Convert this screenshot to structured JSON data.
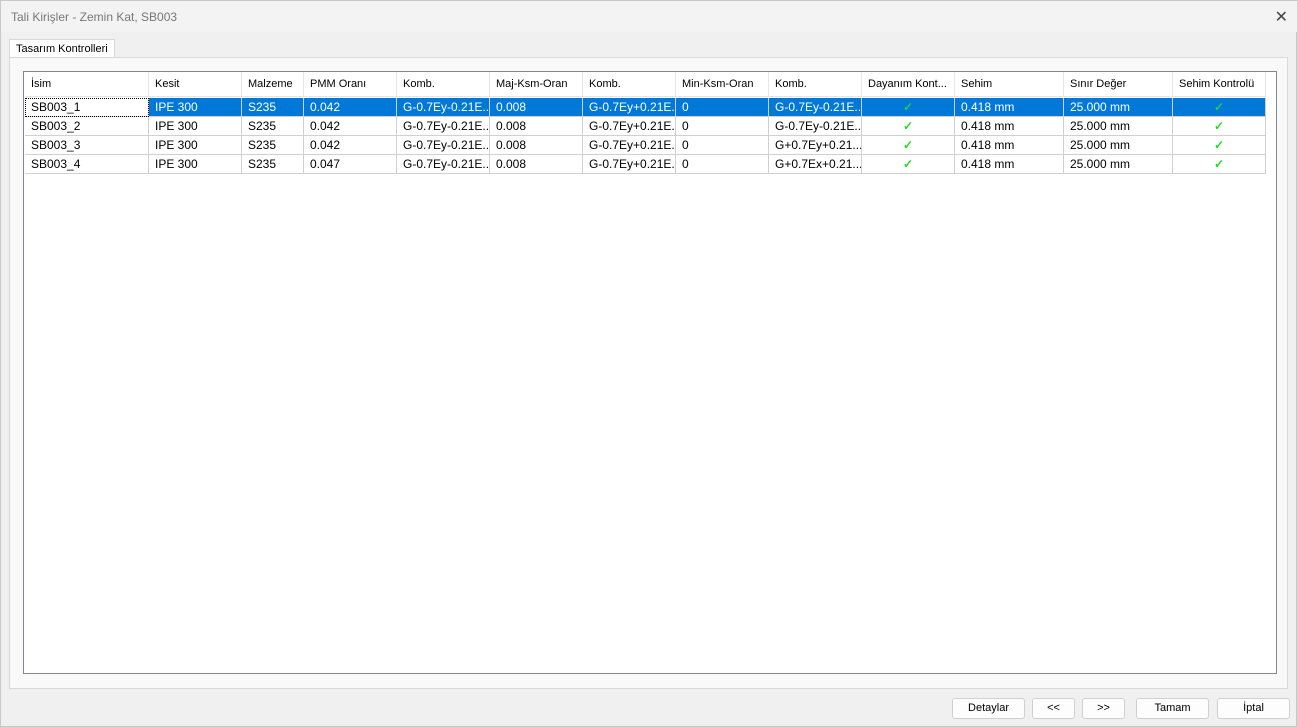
{
  "window": {
    "title": "Tali Kirişler - Zemin Kat, SB003",
    "close_icon": "close-icon"
  },
  "tab": {
    "label": "Tasarım Kontrolleri"
  },
  "table": {
    "columns": [
      "İsim",
      "Kesit",
      "Malzeme",
      "PMM Oranı",
      "Komb.",
      "Maj-Ksm-Oran",
      "Komb.",
      "Min-Ksm-Oran",
      "Komb.",
      "Dayanım Kont...",
      "Sehim",
      "Sınır Değer",
      "Sehim Kontrolü"
    ],
    "rows": [
      [
        "SB003_1",
        "IPE 300",
        "S235",
        "0.042",
        "G-0.7Ey-0.21E...",
        "0.008",
        "G-0.7Ey+0.21E...",
        "0",
        "G-0.7Ey-0.21E...",
        "✓",
        "0.418 mm",
        "25.000 mm",
        "✓"
      ],
      [
        "SB003_2",
        "IPE 300",
        "S235",
        "0.042",
        "G-0.7Ey-0.21E...",
        "0.008",
        "G-0.7Ey+0.21E...",
        "0",
        "G-0.7Ey-0.21E...",
        "✓",
        "0.418 mm",
        "25.000 mm",
        "✓"
      ],
      [
        "SB003_3",
        "IPE 300",
        "S235",
        "0.042",
        "G-0.7Ey-0.21E...",
        "0.008",
        "G-0.7Ey+0.21E...",
        "0",
        "G+0.7Ey+0.21...",
        "✓",
        "0.418 mm",
        "25.000 mm",
        "✓"
      ],
      [
        "SB003_4",
        "IPE 300",
        "S235",
        "0.047",
        "G-0.7Ey-0.21E...",
        "0.008",
        "G-0.7Ey+0.21E...",
        "0",
        "G+0.7Ex+0.21...",
        "✓",
        "0.418 mm",
        "25.000 mm",
        "✓"
      ]
    ],
    "selected_row": 0
  },
  "buttons": {
    "details": "Detaylar",
    "prev": "<<",
    "next": ">>",
    "ok": "Tamam",
    "cancel": "İptal"
  }
}
